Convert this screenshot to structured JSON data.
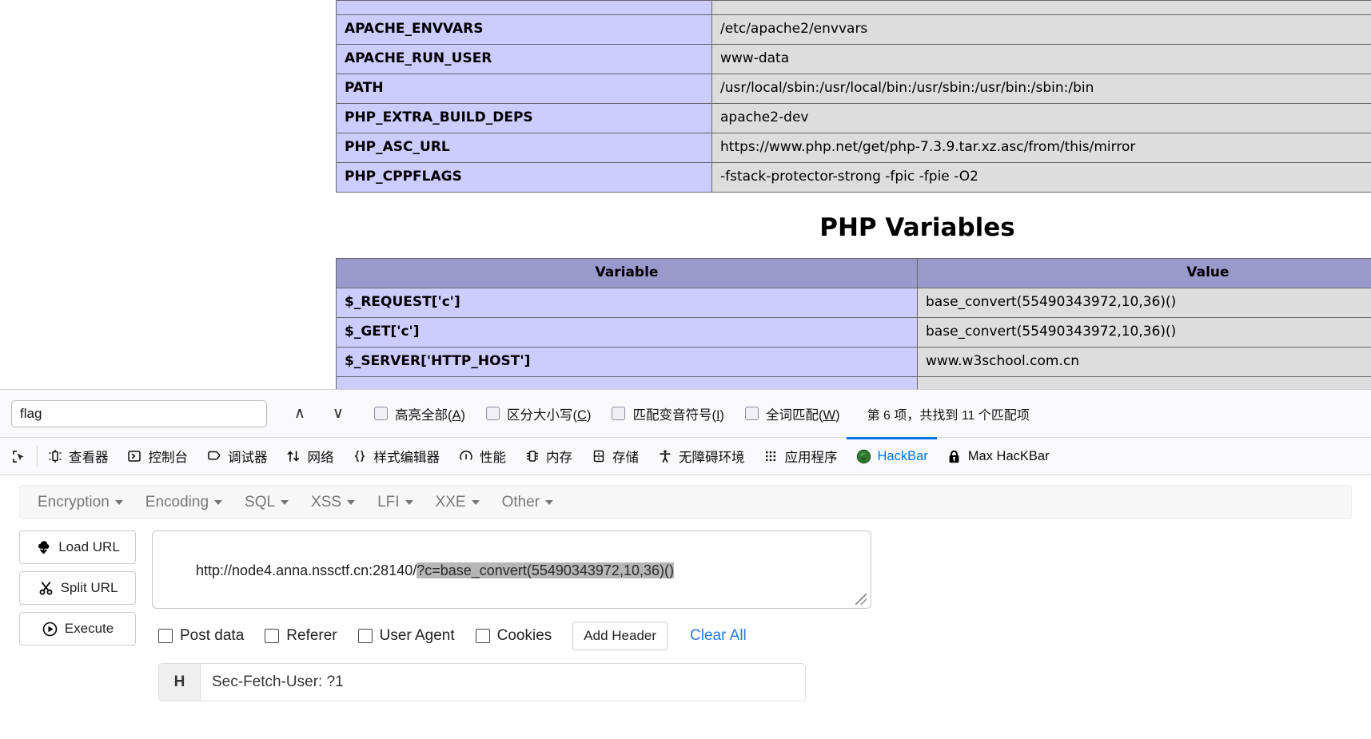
{
  "phpinfo": {
    "env_table": {
      "rows": [
        {
          "key": "APACHE_ENVVARS",
          "value": "/etc/apache2/envvars"
        },
        {
          "key": "APACHE_RUN_USER",
          "value": "www-data"
        },
        {
          "key": "PATH",
          "value": "/usr/local/sbin:/usr/local/bin:/usr/sbin:/usr/bin:/sbin:/bin"
        },
        {
          "key": "PHP_EXTRA_BUILD_DEPS",
          "value": "apache2-dev"
        },
        {
          "key": "PHP_ASC_URL",
          "value": "https://www.php.net/get/php-7.3.9.tar.xz.asc/from/this/mirror"
        },
        {
          "key": "PHP_CPPFLAGS",
          "value": "-fstack-protector-strong -fpic -fpie -O2"
        }
      ]
    },
    "php_variables": {
      "heading": "PHP Variables",
      "columns": [
        "Variable",
        "Value"
      ],
      "rows": [
        {
          "key": "$_REQUEST['c']",
          "value": "base_convert(55490343972,10,36)()"
        },
        {
          "key": "$_GET['c']",
          "value": "base_convert(55490343972,10,36)()"
        },
        {
          "key": "$_SERVER['HTTP_HOST']",
          "value": "www.w3school.com.cn"
        }
      ]
    },
    "colors": {
      "key_bg": "#ccccff",
      "value_bg": "#dddddd",
      "header_bg": "#9999cc"
    }
  },
  "findbar": {
    "query": "flag",
    "placeholder": "",
    "prev_label": "∧",
    "next_label": "∨",
    "options": [
      {
        "label_prefix": "高亮全部(",
        "accel": "A",
        "label_suffix": ")",
        "checked": false
      },
      {
        "label_prefix": "区分大小写(",
        "accel": "C",
        "label_suffix": ")",
        "checked": false
      },
      {
        "label_prefix": "匹配变音符号(",
        "accel": "I",
        "label_suffix": ")",
        "checked": false
      },
      {
        "label_prefix": "全词匹配(",
        "accel": "W",
        "label_suffix": ")",
        "checked": false
      }
    ],
    "status": "第 6 项，共找到 11 个匹配项"
  },
  "devtools": {
    "tabs": [
      {
        "label": "查看器",
        "icon": "inspector-icon",
        "active": false
      },
      {
        "label": "控制台",
        "icon": "console-icon",
        "active": false
      },
      {
        "label": "调试器",
        "icon": "debugger-icon",
        "active": false
      },
      {
        "label": "网络",
        "icon": "network-icon",
        "active": false
      },
      {
        "label": "样式编辑器",
        "icon": "style-editor-icon",
        "active": false
      },
      {
        "label": "性能",
        "icon": "performance-icon",
        "active": false
      },
      {
        "label": "内存",
        "icon": "memory-icon",
        "active": false
      },
      {
        "label": "存储",
        "icon": "storage-icon",
        "active": false
      },
      {
        "label": "无障碍环境",
        "icon": "accessibility-icon",
        "active": false
      },
      {
        "label": "应用程序",
        "icon": "application-icon",
        "active": false
      },
      {
        "label": "HackBar",
        "icon": "hackbar-icon",
        "active": true
      },
      {
        "label": "Max HacKBar",
        "icon": "lock-icon",
        "active": false
      }
    ],
    "active_accent": "#0074e8"
  },
  "hackbar": {
    "menus": [
      {
        "label": "Encryption"
      },
      {
        "label": "Encoding"
      },
      {
        "label": "SQL"
      },
      {
        "label": "XSS"
      },
      {
        "label": "LFI"
      },
      {
        "label": "XXE"
      },
      {
        "label": "Other"
      }
    ],
    "buttons": {
      "load_url": "Load URL",
      "split_url": "Split URL",
      "execute": "Execute"
    },
    "url": {
      "base": "http://node4.anna.nssctf.cn:28140/",
      "selected": "?c=base_convert(55490343972,10,36)()",
      "full": "http://node4.anna.nssctf.cn:28140/?c=base_convert(55490343972,10,36)()"
    },
    "options": [
      {
        "label": "Post data",
        "checked": false
      },
      {
        "label": "Referer",
        "checked": false
      },
      {
        "label": "User Agent",
        "checked": false
      },
      {
        "label": "Cookies",
        "checked": false
      }
    ],
    "add_header_label": "Add Header",
    "clear_all_label": "Clear All",
    "clear_all_color": "#2779d8",
    "headers": [
      {
        "tag": "H",
        "value": "Sec-Fetch-User: ?1"
      }
    ]
  }
}
